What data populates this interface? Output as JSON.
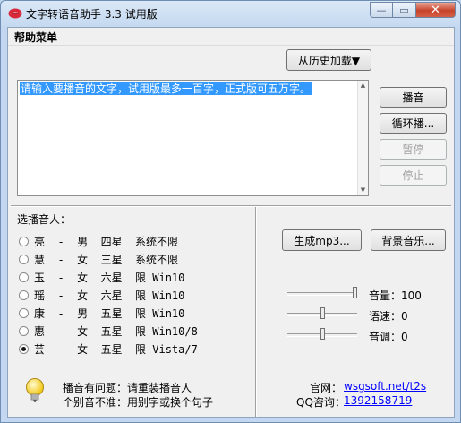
{
  "window": {
    "title": "文字转语音助手 3.3 试用版",
    "minimize_glyph": "—",
    "maximize_glyph": "▭",
    "close_glyph": "✕"
  },
  "menu": {
    "help": "帮助菜单"
  },
  "history_button": "从历史加载▼",
  "text_input": {
    "value": "请输入要播音的文字，试用版最多一百字，正式版可五万字。"
  },
  "buttons": {
    "play": "播音",
    "loop": "循环播...",
    "pause": "暂停",
    "stop": "停止",
    "mp3": "生成mp3...",
    "music": "背景音乐..."
  },
  "speaker_label": "选播音人：",
  "speakers": [
    {
      "text": "亮  -  男  四星  系统不限",
      "checked": false
    },
    {
      "text": "慧  -  女  三星  系统不限",
      "checked": false
    },
    {
      "text": "玉  -  女  六星  限 Win10",
      "checked": false
    },
    {
      "text": "瑶  -  女  六星  限 Win10",
      "checked": false
    },
    {
      "text": "康  -  男  五星  限 Win10",
      "checked": false
    },
    {
      "text": "惠  -  女  五星  限 Win10/8",
      "checked": false
    },
    {
      "text": "芸  -  女  五星  限 Vista/7",
      "checked": true
    }
  ],
  "sliders": {
    "volume": {
      "label": "音量：",
      "value": "100",
      "position": 1.0
    },
    "speed": {
      "label": "语速：",
      "value": "0",
      "position": 0.5
    },
    "pitch": {
      "label": "音调：",
      "value": "0",
      "position": 0.5
    }
  },
  "tips": {
    "line1": "播音有问题：请重装播音人",
    "line2": "个别音不准：用别字或换个句子"
  },
  "contact": {
    "site_label": "官网：",
    "site": "wsgsoft.net/t2s",
    "qq_label": "QQ咨询：",
    "qq": "1392158719"
  },
  "icons": {
    "app": "lips-icon",
    "tip": "lightbulb-icon"
  },
  "colors": {
    "selection": "#3399ff",
    "link": "#0000ff",
    "close": "#c7432b"
  }
}
